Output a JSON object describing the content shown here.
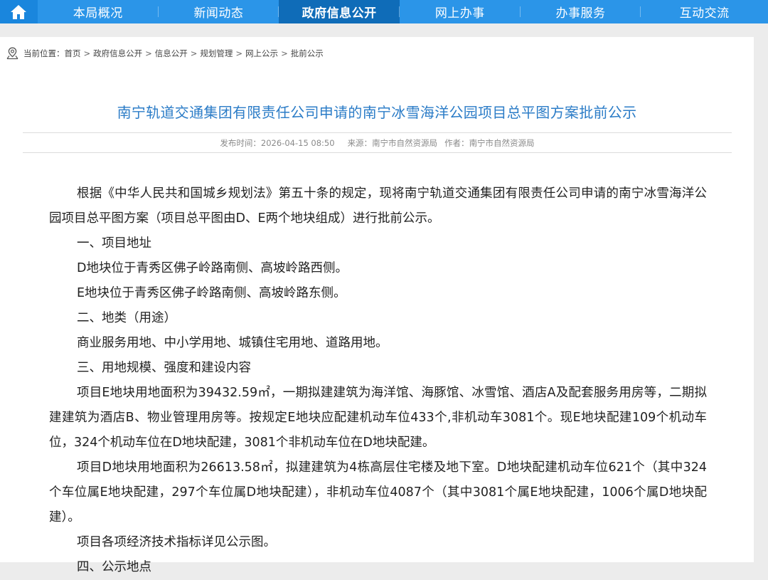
{
  "nav": {
    "home_icon": "home-icon",
    "items": [
      {
        "label": "本局概况"
      },
      {
        "label": "新闻动态"
      },
      {
        "label": "政府信息公开",
        "active": true
      },
      {
        "label": "网上办事"
      },
      {
        "label": "办事服务"
      },
      {
        "label": "互动交流"
      }
    ]
  },
  "breadcrumb": {
    "prefix": "当前位置：",
    "items": [
      "首页",
      "政府信息公开",
      "信息公开",
      "规划管理",
      "网上公示",
      "批前公示"
    ],
    "separator": ">"
  },
  "article": {
    "title": "南宁轨道交通集团有限责任公司申请的南宁冰雪海洋公园项目总平图方案批前公示",
    "publish_label": "发布时间：",
    "publish_time": "2026-04-15 08:50",
    "source_label": "来源：",
    "source": "南宁市自然资源局",
    "author_label": "作者：",
    "author": "南宁市自然资源局",
    "paragraphs": [
      "根据《中华人民共和国城乡规划法》第五十条的规定，现将南宁轨道交通集团有限责任公司申请的南宁冰雪海洋公园项目总平图方案（项目总平图由D、E两个地块组成）进行批前公示。",
      "一、项目地址",
      "D地块位于青秀区佛子岭路南侧、高坡岭路西侧。",
      "E地块位于青秀区佛子岭路南侧、高坡岭路东侧。",
      "二、地类（用途）",
      "商业服务用地、中小学用地、城镇住宅用地、道路用地。",
      "三、用地规模、强度和建设内容",
      "项目E地块用地面积为39432.59㎡，一期拟建建筑为海洋馆、海豚馆、冰雪馆、酒店A及配套服务用房等，二期拟建建筑为酒店B、物业管理用房等。按规定E地块应配建机动车位433个,非机动车3081个。现E地块配建109个机动车位，324个机动车位在D地块配建，3081个非机动车位在D地块配建。",
      "项目D地块用地面积为26613.58㎡，拟建建筑为4栋高层住宅楼及地下室。D地块配建机动车位621个（其中324个车位属E地块配建，297个车位属D地块配建），非机动车位4087个（其中3081个属E地块配建，1006个属D地块配建）。",
      "项目各项经济技术指标详见公示图。",
      "四、公示地点"
    ]
  },
  "colors": {
    "nav_bg": "#2b95e8",
    "nav_active": "#0f6cb8",
    "title": "#2b7cc7"
  }
}
